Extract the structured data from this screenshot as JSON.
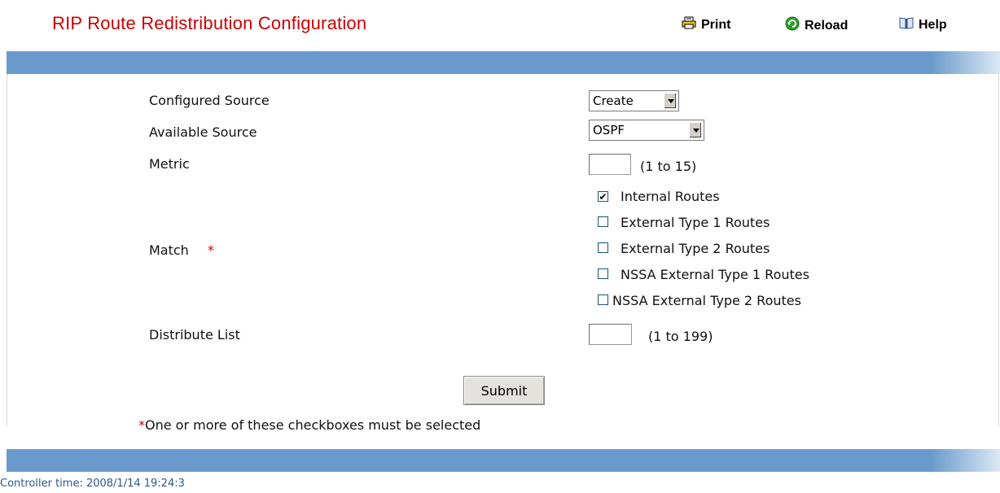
{
  "header": {
    "title": "RIP Route Redistribution Configuration",
    "print_label": "Print",
    "reload_label": "Reload",
    "help_label": "Help"
  },
  "form": {
    "configured_source": {
      "label": "Configured Source",
      "value": "Create"
    },
    "available_source": {
      "label": "Available Source",
      "value": "OSPF"
    },
    "metric": {
      "label": "Metric",
      "value": "",
      "hint": "(1 to 15)"
    },
    "match": {
      "label": "Match",
      "required_mark": "*",
      "options": [
        {
          "label": "Internal Routes",
          "checked": true
        },
        {
          "label": "External Type 1 Routes",
          "checked": false
        },
        {
          "label": "External Type 2 Routes",
          "checked": false
        },
        {
          "label": "NSSA External Type 1 Routes",
          "checked": false
        },
        {
          "label": "NSSA External Type 2 Routes",
          "checked": false
        }
      ]
    },
    "distribute_list": {
      "label": "Distribute List",
      "value": "",
      "hint": "(1 to 199)"
    },
    "submit_label": "Submit",
    "note_star": "*",
    "note_text": "One or more of these checkboxes must be selected"
  },
  "footer": {
    "controller_time": "Controller time: 2008/1/14 19:24:3"
  },
  "colors": {
    "title": "#cc0000",
    "bar": "#6a9acb",
    "footer_text": "#2a5a8a"
  },
  "icons": {
    "print": "printer-icon",
    "reload": "reload-icon",
    "help": "help-book-icon"
  }
}
